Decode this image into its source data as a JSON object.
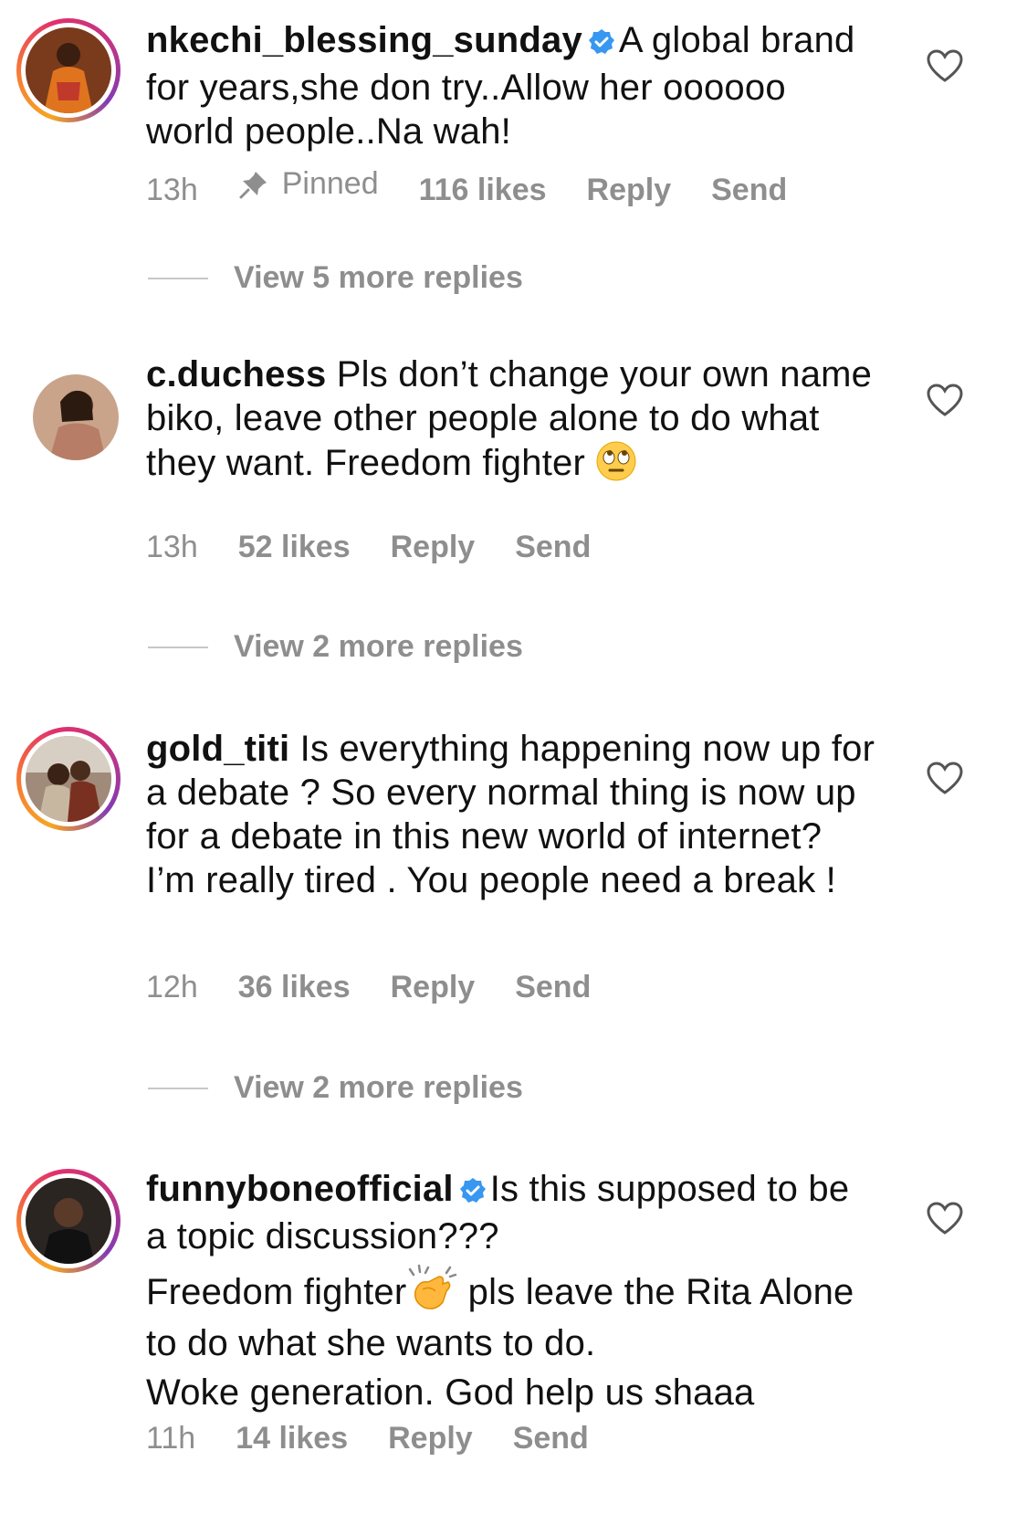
{
  "comments": [
    {
      "username": "nkechi_blessing_sunday",
      "verified": true,
      "text": "A global brand for years,she don try..Allow her oooooo world people..Na wah!",
      "time": "13h",
      "pinned_label": "Pinned",
      "likes": "116 likes",
      "reply_label": "Reply",
      "send_label": "Send",
      "view_replies": "View 5 more replies",
      "avatar_ring": true
    },
    {
      "username": "c.duchess",
      "verified": false,
      "text": "Pls don’t change your own name biko, leave other people alone to do what they want. Freedom fighter",
      "emoji": "face-with-rolling-eyes",
      "time": "13h",
      "likes": "52 likes",
      "reply_label": "Reply",
      "send_label": "Send",
      "view_replies": "View 2 more replies",
      "avatar_ring": false
    },
    {
      "username": "gold_titi",
      "verified": false,
      "text": "Is everything happening now up for a debate ? So every normal thing is now up for a debate in this new world of internet? I’m really tired . You people need a break !",
      "time": "12h",
      "likes": "36 likes",
      "reply_label": "Reply",
      "send_label": "Send",
      "view_replies": "View 2 more replies",
      "avatar_ring": true
    },
    {
      "username": "funnyboneofficial",
      "verified": true,
      "text_line1": "Is this supposed to be a topic discussion???",
      "text_line2a": "Freedom fighter",
      "emoji": "clapping-hands",
      "text_line2b": " pls leave the Rita Alone to do what she wants to do.",
      "text_line3": "Woke generation. God help us shaaa",
      "time": "11h",
      "likes": "14 likes",
      "reply_label": "Reply",
      "send_label": "Send",
      "avatar_ring": true
    }
  ],
  "colors": {
    "muted": "#8e8e8e",
    "verified_blue": "#3897f0",
    "text": "#111111"
  }
}
